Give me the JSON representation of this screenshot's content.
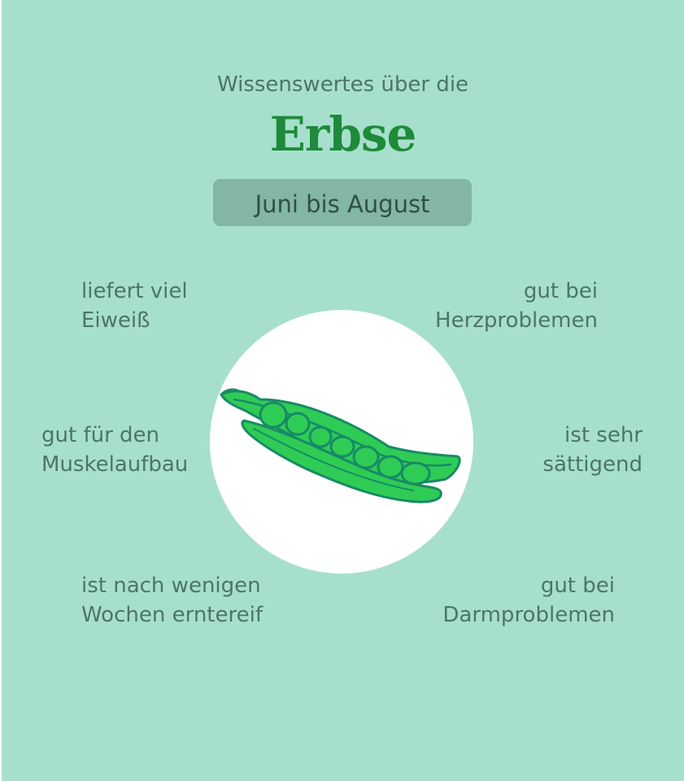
{
  "header": {
    "intro": "Wissenswertes über die",
    "title": "Erbse",
    "season": "Juni bis August"
  },
  "facts": {
    "top_left": [
      "liefert viel",
      "Eiweiß"
    ],
    "top_right": [
      "gut bei",
      "Herzproblemen"
    ],
    "middle_left": [
      "gut für den",
      "Muskelaufbau"
    ],
    "middle_right": [
      "ist sehr",
      "sättigend"
    ],
    "bottom_left": [
      "ist nach wenigen",
      "Wochen erntereif"
    ],
    "bottom_right": [
      "gut bei",
      "Darmproblemen"
    ]
  },
  "illustration": {
    "icon": "pea-pod-icon"
  },
  "colors": {
    "background": "#a6e0cc",
    "title": "#1e8a3a",
    "text": "#4d7567",
    "season_badge": "#83b6a3",
    "pea_fill": "#2ecc55",
    "pea_outline": "#188a66"
  }
}
